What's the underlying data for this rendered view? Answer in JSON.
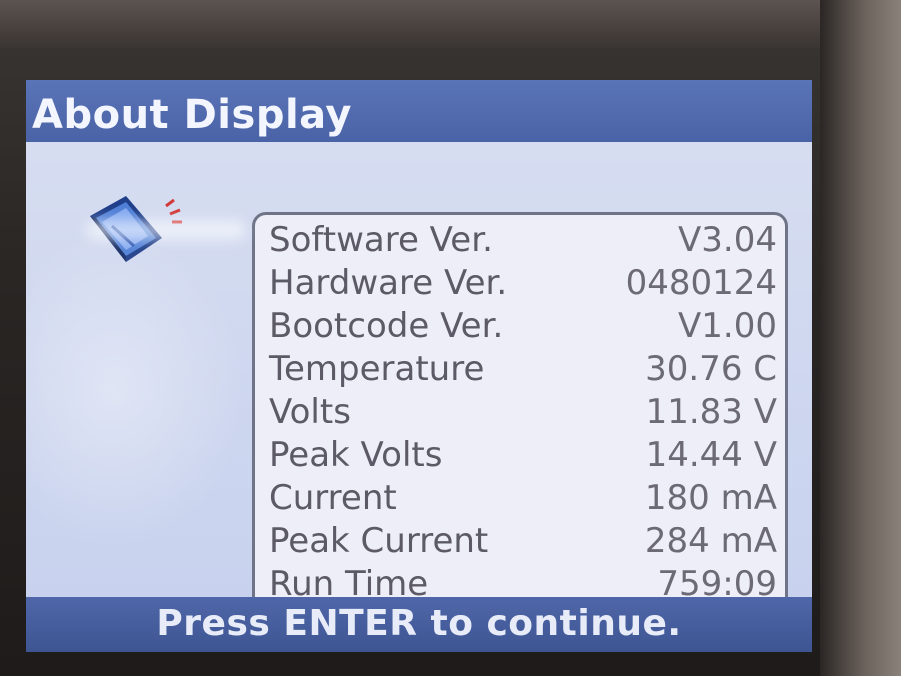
{
  "window": {
    "title": "About Display"
  },
  "info": {
    "rows": [
      {
        "label": "Software Ver.",
        "value": "V3.04"
      },
      {
        "label": "Hardware Ver.",
        "value": "0480124"
      },
      {
        "label": "Bootcode Ver.",
        "value": "V1.00"
      },
      {
        "label": "Temperature",
        "value": "30.76 C"
      },
      {
        "label": "Volts",
        "value": "11.83 V"
      },
      {
        "label": "Peak Volts",
        "value": "14.44 V"
      },
      {
        "label": "Current",
        "value": "180 mA"
      },
      {
        "label": "Peak Current",
        "value": "284 mA"
      },
      {
        "label": "Run Time",
        "value": "759:09"
      }
    ]
  },
  "footer": {
    "prompt": "Press ENTER to continue."
  },
  "icons": {
    "about": "display-book-icon"
  },
  "colors": {
    "title_bar": "#4a63a6",
    "screen_bg": "#c8d2ee",
    "panel_bg": "#eeeef8",
    "panel_border": "#6f7488",
    "text": "#5c5a66",
    "footer_bar": "#3e5593"
  }
}
